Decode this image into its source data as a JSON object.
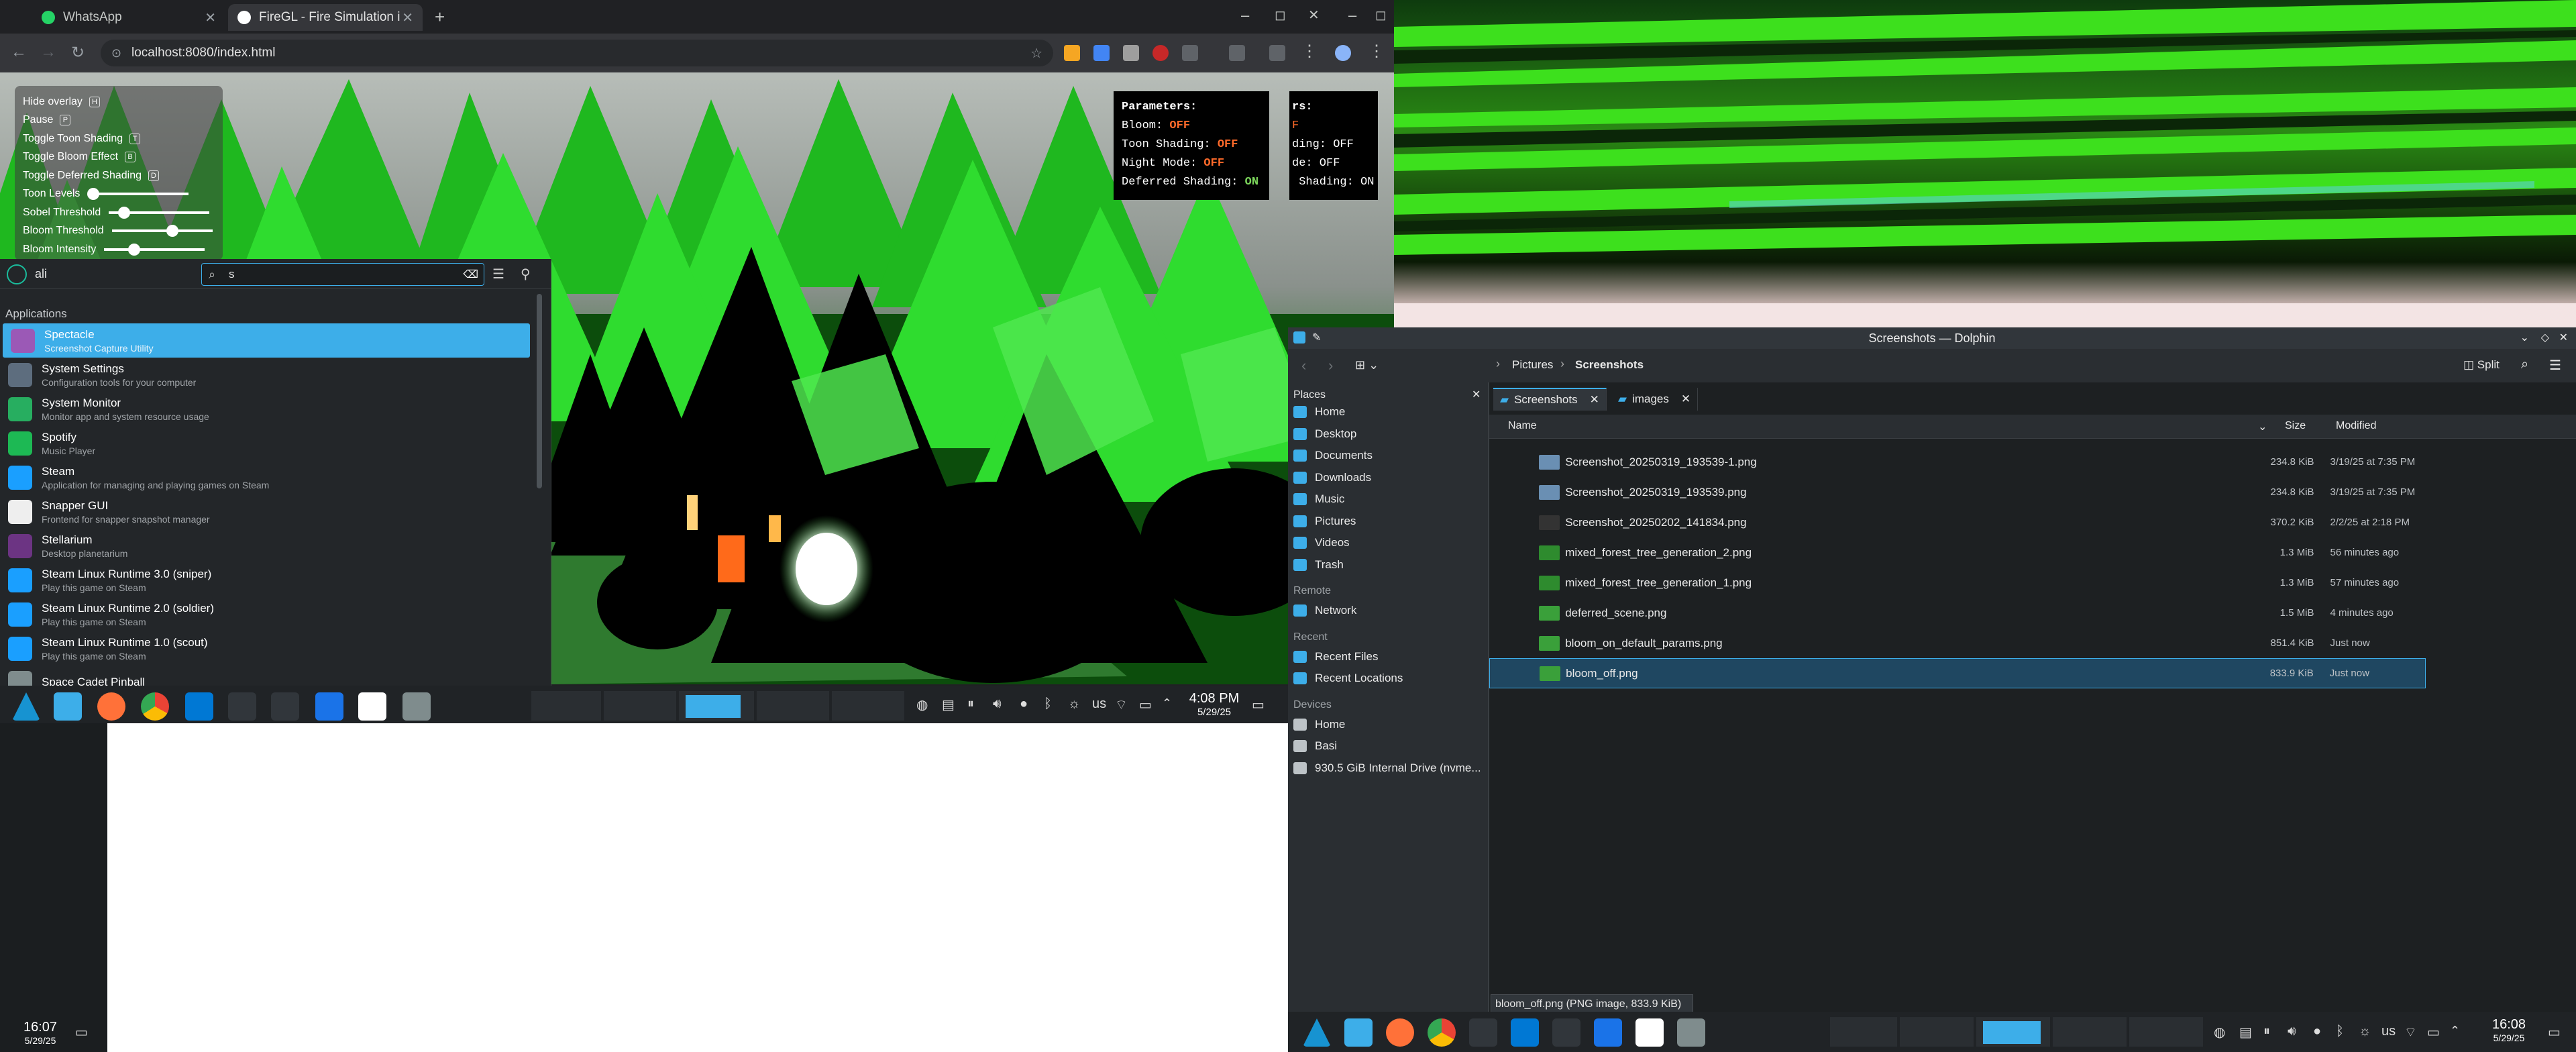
{
  "browser": {
    "tabs": [
      {
        "label": "WhatsApp",
        "favicon_color": "#25d366"
      },
      {
        "label": "FireGL - Fire Simulation in W",
        "favicon_color": "#ffffff"
      }
    ],
    "url": "localhost:8080/index.html"
  },
  "overlay": {
    "items": [
      "Hide overlay",
      "Pause",
      "Toggle Toon Shading",
      "Toggle Bloom Effect",
      "Toggle Deferred Shading"
    ],
    "keys": [
      "H",
      "P",
      "T",
      "B",
      "D"
    ],
    "sliders": [
      {
        "label": "Toon Levels",
        "value": 0.05
      },
      {
        "label": "Sobel Threshold",
        "value": 0.15
      },
      {
        "label": "Bloom Threshold",
        "value": 0.6
      },
      {
        "label": "Bloom Intensity",
        "value": 0.3
      }
    ]
  },
  "params": {
    "heading": "Parameters:",
    "rows": [
      {
        "label": "Bloom: ",
        "value": "OFF",
        "state": "off"
      },
      {
        "label": "Toon Shading: ",
        "value": "OFF",
        "state": "off"
      },
      {
        "label": "Night Mode: ",
        "value": "OFF",
        "state": "off"
      },
      {
        "label": "Deferred Shading: ",
        "value": "ON",
        "state": "on"
      }
    ],
    "clipped": {
      "heading": "rs:",
      "rows": [
        "F",
        "ding: OFF",
        "de: OFF",
        " Shading: ON"
      ]
    }
  },
  "krunner": {
    "user": "ali",
    "query": "s",
    "section": "Applications",
    "items": [
      {
        "title": "Spectacle",
        "subtitle": "Screenshot Capture Utility",
        "color": "#9b59b6"
      },
      {
        "title": "System Settings",
        "subtitle": "Configuration tools for your computer",
        "color": "#5d6d7e"
      },
      {
        "title": "System Monitor",
        "subtitle": "Monitor app and system resource usage",
        "color": "#27ae60"
      },
      {
        "title": "Spotify",
        "subtitle": "Music Player",
        "color": "#1db954"
      },
      {
        "title": "Steam",
        "subtitle": "Application for managing and playing games on Steam",
        "color": "#1a9fff"
      },
      {
        "title": "Snapper GUI",
        "subtitle": "Frontend for snapper snapshot manager",
        "color": "#eeeeee"
      },
      {
        "title": "Stellarium",
        "subtitle": "Desktop planetarium",
        "color": "#6c3483"
      },
      {
        "title": "Steam Linux Runtime 3.0 (sniper)",
        "subtitle": "Play this game on Steam",
        "color": "#1a9fff"
      },
      {
        "title": "Steam Linux Runtime 2.0 (soldier)",
        "subtitle": "Play this game on Steam",
        "color": "#1a9fff"
      },
      {
        "title": "Steam Linux Runtime 1.0 (scout)",
        "subtitle": "Play this game on Steam",
        "color": "#1a9fff"
      },
      {
        "title": "Space Cadet Pinball",
        "subtitle": "",
        "color": "#7f8c8d"
      }
    ]
  },
  "taskbar_left": {
    "time": "4:08 PM",
    "date": "5/29/25",
    "layout": "us"
  },
  "bottom_clock_left": {
    "time": "16:07",
    "date": "5/29/25"
  },
  "dolphin": {
    "title": "Screenshots — Dolphin",
    "breadcrumb": [
      "Pictures",
      "Screenshots"
    ],
    "split_label": "Split",
    "tabs": [
      "Screenshots",
      "images"
    ],
    "places": {
      "header": "Places",
      "items": [
        "Home",
        "Desktop",
        "Documents",
        "Downloads",
        "Music",
        "Pictures",
        "Videos",
        "Trash"
      ],
      "remote_header": "Remote",
      "remote_items": [
        "Network"
      ],
      "recent_header": "Recent",
      "recent_items": [
        "Recent Files",
        "Recent Locations"
      ],
      "devices_header": "Devices",
      "devices_items": [
        "Home",
        "Basi",
        "930.5 GiB Internal Drive (nvme..."
      ]
    },
    "columns": [
      "Name",
      "Size",
      "Modified"
    ],
    "files": [
      {
        "name": "Screenshot_20250319_193539-1.png",
        "size": "234.8 KiB",
        "modified": "3/19/25 at 7:35 PM",
        "thumb": "#6a8fb3"
      },
      {
        "name": "Screenshot_20250319_193539.png",
        "size": "234.8 KiB",
        "modified": "3/19/25 at 7:35 PM",
        "thumb": "#6a8fb3"
      },
      {
        "name": "Screenshot_20250202_141834.png",
        "size": "370.2 KiB",
        "modified": "2/2/25 at 2:18 PM",
        "thumb": "#333333"
      },
      {
        "name": "mixed_forest_tree_generation_2.png",
        "size": "1.3 MiB",
        "modified": "56 minutes ago",
        "thumb": "#2e8b2e"
      },
      {
        "name": "mixed_forest_tree_generation_1.png",
        "size": "1.3 MiB",
        "modified": "57 minutes ago",
        "thumb": "#2e8b2e"
      },
      {
        "name": "deferred_scene.png",
        "size": "1.5 MiB",
        "modified": "4 minutes ago",
        "thumb": "#3aa03a"
      },
      {
        "name": "bloom_on_default_params.png",
        "size": "851.4 KiB",
        "modified": "Just now",
        "thumb": "#3aa03a"
      },
      {
        "name": "bloom_off.png",
        "size": "833.9 KiB",
        "modified": "Just now",
        "thumb": "#3aa03a"
      }
    ],
    "tooltip": "bloom_off.png (PNG image, 833.9 KiB)"
  },
  "taskbar_right": {
    "time": "16:08",
    "date": "5/29/25",
    "layout": "us"
  },
  "colors": {
    "accent": "#3daee9",
    "panel": "#202326"
  }
}
